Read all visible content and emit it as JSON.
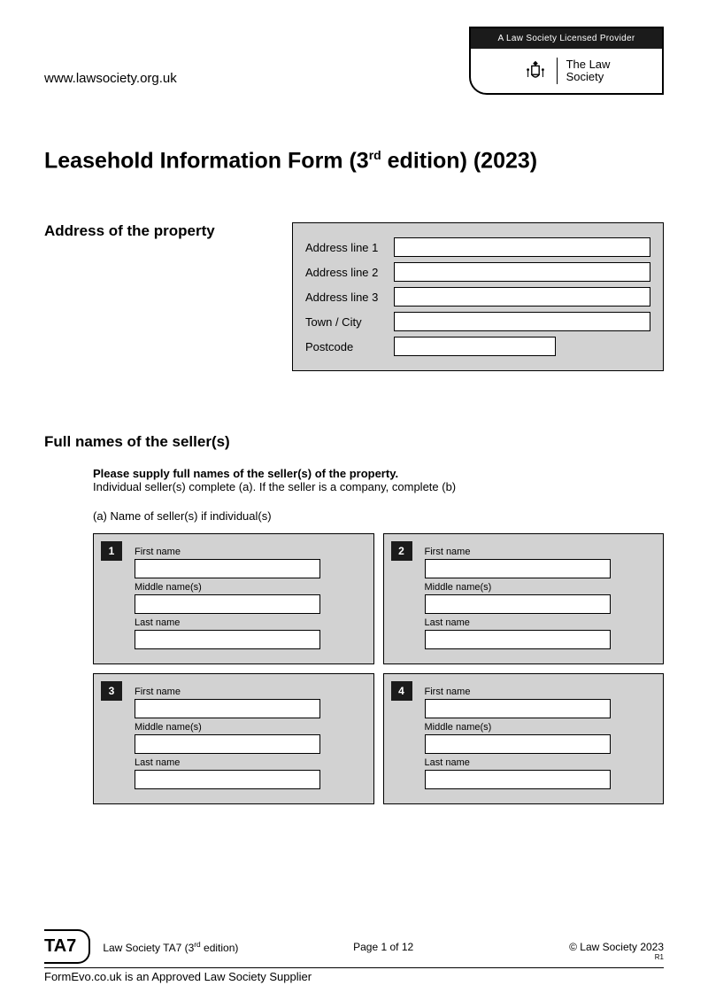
{
  "header": {
    "website": "www.lawsociety.org.uk",
    "provider_bar": "A Law Society Licensed Provider",
    "logo_line1": "The Law",
    "logo_line2": "Society"
  },
  "title": {
    "pre": "Leasehold Information Form (3",
    "sup": "rd",
    "post": " edition) (2023)"
  },
  "address_section": {
    "heading": "Address of the property",
    "rows": [
      {
        "label": "Address line 1",
        "short": false
      },
      {
        "label": "Address line 2",
        "short": false
      },
      {
        "label": "Address line 3",
        "short": false
      },
      {
        "label": "Town / City",
        "short": false
      },
      {
        "label": "Postcode",
        "short": true
      }
    ]
  },
  "sellers_section": {
    "heading": "Full names of the seller(s)",
    "instruction_strong": "Please supply full names of the seller(s) of the property.",
    "instruction_rest": "Individual seller(s) complete (a). If the seller is a company, complete (b)",
    "sub_a": "(a) Name of seller(s) if individual(s)",
    "field_labels": {
      "first": "First name",
      "middle": "Middle name(s)",
      "last": "Last name"
    },
    "count": 4
  },
  "footer": {
    "badge": "TA7",
    "left_pre": "Law Society TA7 (3",
    "left_sup": "rd",
    "left_post": " edition)",
    "center": "Page 1 of 12",
    "right": "© Law Society 2023",
    "rev": "R1",
    "supplier": "FormEvo.co.uk is an Approved Law Society Supplier"
  }
}
